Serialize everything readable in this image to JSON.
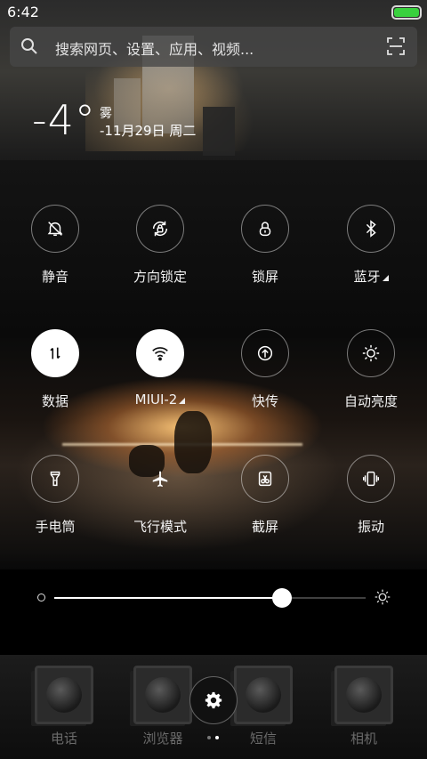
{
  "status_bar": {
    "time": "6:42",
    "battery_color": "#39d13e"
  },
  "search": {
    "placeholder": "搜索网页、设置、应用、视频..."
  },
  "weather": {
    "temperature": "-4°",
    "condition": "雾",
    "date": "-11月29日 周二"
  },
  "toggles": [
    {
      "label": "静音",
      "icon": "bell-off-icon",
      "active": false
    },
    {
      "label": "方向锁定",
      "icon": "rotation-lock-icon",
      "active": false
    },
    {
      "label": "锁屏",
      "icon": "lock-icon",
      "active": false
    },
    {
      "label": "蓝牙",
      "icon": "bluetooth-icon",
      "active": false
    },
    {
      "label": "数据",
      "icon": "mobile-data-icon",
      "active": true
    },
    {
      "label": "MIUI-2",
      "icon": "wifi-icon",
      "active": true
    },
    {
      "label": "快传",
      "icon": "transfer-icon",
      "active": false
    },
    {
      "label": "自动亮度",
      "icon": "brightness-auto-icon",
      "active": false
    },
    {
      "label": "手电筒",
      "icon": "flashlight-icon",
      "active": false
    },
    {
      "label": "飞行模式",
      "icon": "airplane-icon",
      "active": false
    },
    {
      "label": "截屏",
      "icon": "screenshot-icon",
      "active": false
    },
    {
      "label": "振动",
      "icon": "vibrate-icon",
      "active": false
    }
  ],
  "brightness": {
    "level": 0.73
  },
  "dock": {
    "apps": [
      {
        "label": "电话",
        "icon": "phone-app-icon"
      },
      {
        "label": "浏览器",
        "icon": "browser-app-icon"
      },
      {
        "label": "短信",
        "icon": "messages-app-icon"
      },
      {
        "label": "相机",
        "icon": "camera-app-icon"
      }
    ],
    "settings_icon": "gear-icon",
    "pages": {
      "count": 2,
      "current": 2
    }
  }
}
